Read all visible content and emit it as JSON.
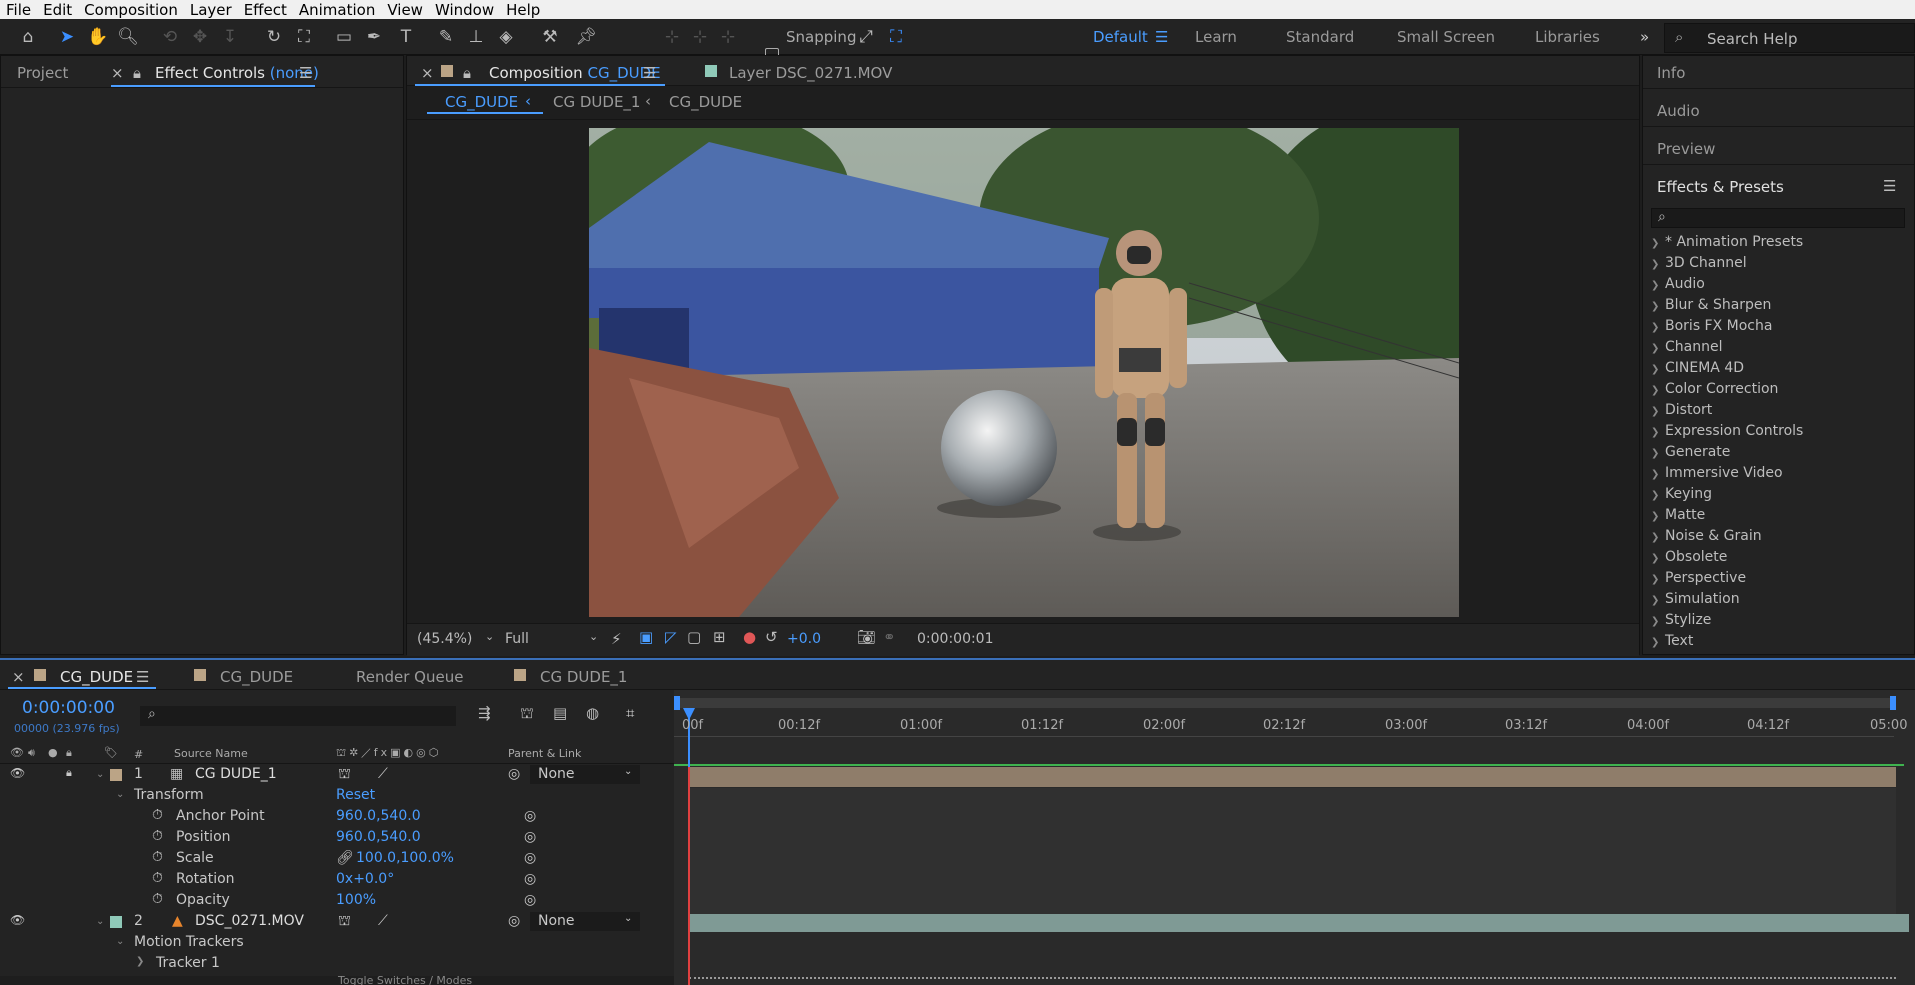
{
  "menu": [
    "File",
    "Edit",
    "Composition",
    "Layer",
    "Effect",
    "Animation",
    "View",
    "Window",
    "Help"
  ],
  "toolbar": {
    "snapping_label": "Snapping",
    "workspaces": [
      "Default",
      "Learn",
      "Standard",
      "Small Screen",
      "Libraries"
    ],
    "active_workspace": "Default",
    "search_placeholder": "Search Help",
    "more": "»"
  },
  "left_panel": {
    "tab_project": "Project",
    "tab_effect_controls": "Effect Controls",
    "effect_controls_target": "(none)"
  },
  "viewer": {
    "tab_composition_prefix": "Composition",
    "tab_composition_name": "CG_DUDE",
    "tab_layer_prefix": "Layer",
    "tab_layer_name": "DSC_0271.MOV",
    "breadcrumbs": [
      "CG_DUDE",
      "CG DUDE_1",
      "CG_DUDE"
    ],
    "zoom": "(45.4%)",
    "resolution": "Full",
    "exposure": "+0.0",
    "timecode": "0:00:00:01"
  },
  "right_panel": {
    "info": "Info",
    "audio": "Audio",
    "preview": "Preview",
    "effects_title": "Effects & Presets",
    "effects": [
      "* Animation Presets",
      "3D Channel",
      "Audio",
      "Blur & Sharpen",
      "Boris FX Mocha",
      "Channel",
      "CINEMA 4D",
      "Color Correction",
      "Distort",
      "Expression Controls",
      "Generate",
      "Immersive Video",
      "Keying",
      "Matte",
      "Noise & Grain",
      "Obsolete",
      "Perspective",
      "Simulation",
      "Stylize",
      "Text"
    ]
  },
  "timeline": {
    "tabs": [
      "CG_DUDE",
      "CG_DUDE",
      "Render Queue",
      "CG DUDE_1"
    ],
    "current_time": "0:00:00:00",
    "frame_info": "00000 (23.976 fps)",
    "col_hash": "#",
    "col_source": "Source Name",
    "col_parent": "Parent & Link",
    "ruler": [
      "00f",
      "00:12f",
      "01:00f",
      "01:12f",
      "02:00f",
      "02:12f",
      "03:00f",
      "03:12f",
      "04:00f",
      "04:12f",
      "05:00"
    ],
    "layers": [
      {
        "num": "1",
        "name": "CG DUDE_1",
        "parent": "None"
      },
      {
        "num": "2",
        "name": "DSC_0271.MOV",
        "parent": "None"
      }
    ],
    "transform_label": "Transform",
    "reset_label": "Reset",
    "props": [
      {
        "name": "Anchor Point",
        "value": "960.0,540.0"
      },
      {
        "name": "Position",
        "value": "960.0,540.0"
      },
      {
        "name": "Scale",
        "value": "100.0,100.0%"
      },
      {
        "name": "Rotation",
        "value": "0x+0.0°"
      },
      {
        "name": "Opacity",
        "value": "100%"
      }
    ],
    "motion_trackers": "Motion Trackers",
    "tracker1": "Tracker 1",
    "footer": "Toggle Switches / Modes"
  },
  "colors": {
    "accent": "#4a9dff",
    "layer1_bar": "#8f7d6a",
    "layer2_bar": "#7f9a95",
    "green_line": "#3fb34f",
    "label_tan": "#bba486",
    "label_teal": "#8fc9b8"
  }
}
